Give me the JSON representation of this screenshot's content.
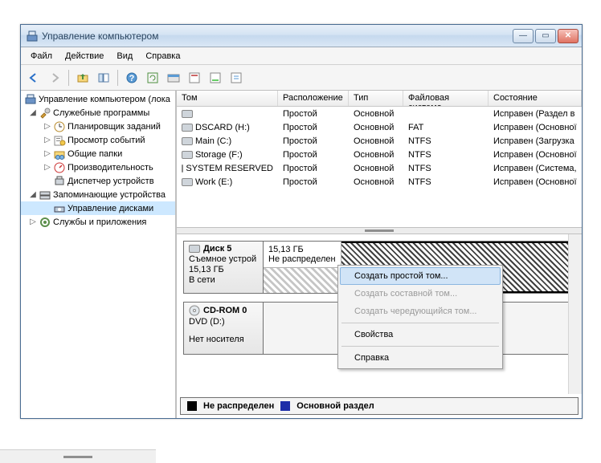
{
  "window": {
    "title": "Управление компьютером"
  },
  "menu": {
    "file": "Файл",
    "action": "Действие",
    "view": "Вид",
    "help": "Справка"
  },
  "tree": {
    "root": "Управление компьютером (лока",
    "sys_tools": "Служебные программы",
    "task_sched": "Планировщик заданий",
    "event_viewer": "Просмотр событий",
    "shared": "Общие папки",
    "perf": "Производительность",
    "devmgr": "Диспетчер устройств",
    "storage": "Запоминающие устройства",
    "diskmgmt": "Управление дисками",
    "services": "Службы и приложения"
  },
  "cols": {
    "c0": "Том",
    "c1": "Расположение",
    "c2": "Тип",
    "c3": "Файловая система",
    "c4": "Состояние"
  },
  "vols": [
    {
      "name": "",
      "layout": "Простой",
      "type": "Основной",
      "fs": "",
      "status": "Исправен (Раздел в"
    },
    {
      "name": "DSCARD (H:)",
      "layout": "Простой",
      "type": "Основной",
      "fs": "FAT",
      "status": "Исправен (Основної"
    },
    {
      "name": "Main (C:)",
      "layout": "Простой",
      "type": "Основной",
      "fs": "NTFS",
      "status": "Исправен (Загрузка"
    },
    {
      "name": "Storage (F:)",
      "layout": "Простой",
      "type": "Основной",
      "fs": "NTFS",
      "status": "Исправен (Основної"
    },
    {
      "name": "SYSTEM RESERVED",
      "layout": "Простой",
      "type": "Основной",
      "fs": "NTFS",
      "status": "Исправен (Система,"
    },
    {
      "name": "Work (E:)",
      "layout": "Простой",
      "type": "Основной",
      "fs": "NTFS",
      "status": "Исправен (Основної"
    }
  ],
  "disk5": {
    "title": "Диск 5",
    "kind": "Съемное устрой",
    "size": "15,13 ГБ",
    "status": "В сети",
    "part_size": "15,13 ГБ",
    "part_label": "Не распределен"
  },
  "cdrom": {
    "title": "CD-ROM 0",
    "drive": "DVD (D:)",
    "status": "Нет носителя"
  },
  "legend": {
    "unalloc": "Не распределен",
    "primary": "Основной раздел"
  },
  "ctx": {
    "simple": "Создать простой том...",
    "spanned": "Создать составной том...",
    "striped": "Создать чередующийся том...",
    "props": "Свойства",
    "help": "Справка"
  }
}
